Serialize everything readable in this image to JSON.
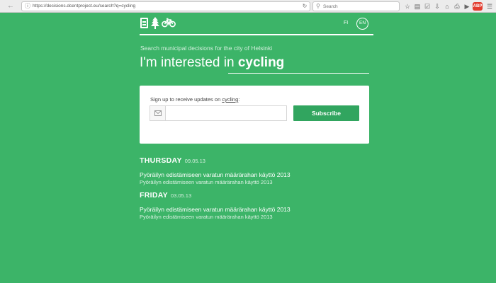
{
  "browser": {
    "url": "https://decisions.dcentproject.eu/search?q=cycling",
    "search_placeholder": "Search",
    "toolbar_icons": [
      "back-icon",
      "url-info-icon",
      "reload-icon",
      "search-icon",
      "star-icon",
      "reading-list-icon",
      "pocket-icon",
      "download-icon",
      "home-icon",
      "print-icon",
      "sync-icon",
      "addon-badge-icon",
      "menu-icon"
    ],
    "addon_badge": "ABP"
  },
  "header": {
    "logo_icons": [
      "document-icon",
      "tree-icon",
      "bicycle-icon"
    ],
    "languages": [
      {
        "code": "FI",
        "active": false
      },
      {
        "code": "EN",
        "active": true
      }
    ]
  },
  "hero": {
    "subtitle": "Search municipal decisions for the city of Helsinki",
    "prefix": "I'm interested in",
    "query": "cycling"
  },
  "signup": {
    "text": "Sign up to receive updates on",
    "topic": "cycling",
    "suffix": ":",
    "email_placeholder": "",
    "button_label": "Subscribe"
  },
  "results": [
    {
      "day": "THURSDAY",
      "date": "09.05.13",
      "title": "Pyöräilyn edistämiseen varatun määrärahan käyttö 2013",
      "subtitle": "Pyöräilyn edistämiseen varatun määrärahan käyttö 2013"
    },
    {
      "day": "FRIDAY",
      "date": "03.05.13",
      "title": "Pyöräilyn edistämiseen varatun määrärahan käyttö 2013",
      "subtitle": "Pyöräilyn edistämiseen varatun määrärahan käyttö 2013"
    }
  ],
  "colors": {
    "page_background": "#3cb468",
    "button": "#31a55f",
    "card": "#ffffff"
  }
}
